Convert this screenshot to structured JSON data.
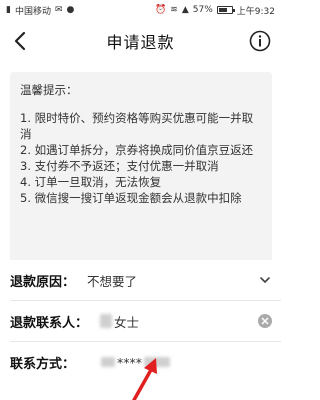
{
  "status_bar": {
    "carrier": "中国移动",
    "battery": "57%",
    "battery_level": 0.57,
    "time": "上午9:32"
  },
  "nav": {
    "title": "申请退款"
  },
  "tips": {
    "title": "温馨提示：",
    "items": [
      "1. 限时特价、预约资格等购买优惠可能一并取消",
      "2. 如遇订单拆分，京券将换成同价值京豆返还",
      "3. 支付券不予返还；支付优惠一并取消",
      "4. 订单一旦取消，无法恢复",
      "5. 微信搜一搜订单返现金额会从退款中扣除"
    ]
  },
  "form": {
    "reason_label": "退款原因：",
    "reason_value": "不想要了",
    "contact_label": "退款联系人：",
    "contact_suffix": "女士",
    "phone_label": "联系方式：",
    "phone_masked": "****"
  },
  "colors": {
    "arrow": "#e02020",
    "tips_bg": "#f3f3f3"
  }
}
